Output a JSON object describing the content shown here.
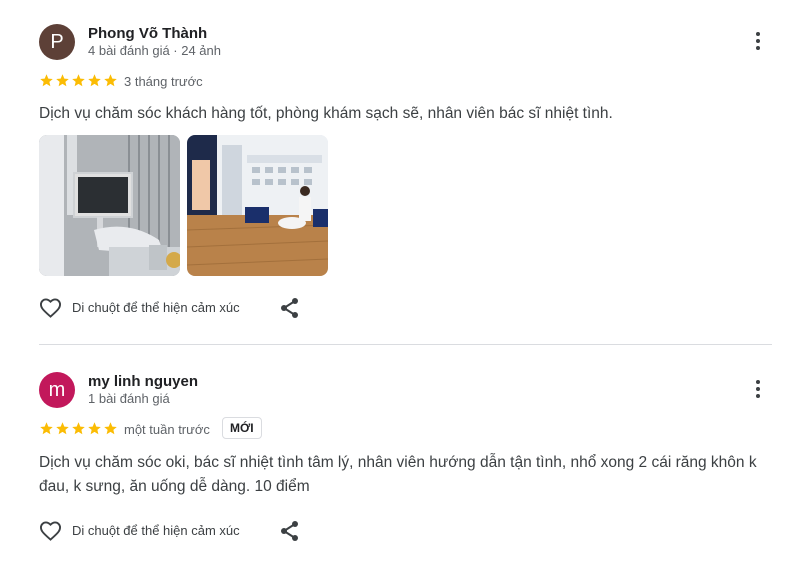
{
  "reviews": [
    {
      "avatar_letter": "P",
      "avatar_color": "#5d4037",
      "name": "Phong Võ Thành",
      "meta": "4 bài đánh giá · 24 ảnh",
      "rating": 5,
      "time": "3 tháng trước",
      "text": "Dịch vụ chăm sóc khách hàng tốt, phòng khám sạch sẽ, nhân viên bác sĩ nhiệt tình.",
      "photos": [
        "dental-chair-photo",
        "clinic-waiting-room-photo"
      ],
      "reaction_label": "Di chuột để thể hiện cảm xúc"
    },
    {
      "avatar_letter": "m",
      "avatar_color": "#c2185b",
      "name": "my linh nguyen",
      "meta": "1 bài đánh giá",
      "rating": 5,
      "time": "một tuần trước",
      "badge": "MỚI",
      "text_line1": "Dịch vụ chăm sóc oki, bác sĩ nhiệt tình tâm lý, nhân viên hướng dẫn tận tình, nhổ xong 2 cái răng khôn k",
      "text_line2": "đau, k sưng, ăn uống dễ dàng. 10 điểm",
      "reaction_label": "Di chuột để thể hiện cảm xúc"
    }
  ],
  "icons": {
    "star": "star-icon",
    "more": "more-vert-icon",
    "heart": "heart-outline-icon",
    "share": "share-icon"
  },
  "colors": {
    "star": "#fbbc04",
    "divider": "#dadce0"
  }
}
